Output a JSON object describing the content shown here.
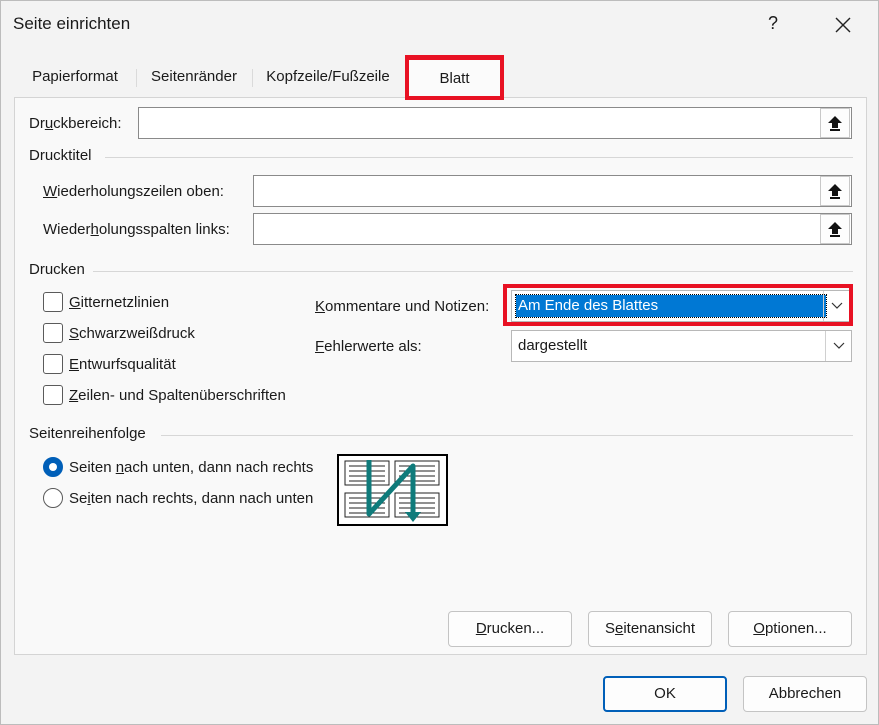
{
  "window": {
    "title": "Seite einrichten",
    "help_label": "?"
  },
  "tabs": [
    {
      "label": "Papierformat"
    },
    {
      "label": "Seitenränder"
    },
    {
      "label": "Kopfzeile/Fußzeile"
    },
    {
      "label": "Blatt",
      "active": true
    }
  ],
  "print_area": {
    "label_pre": "Dr",
    "label_u": "u",
    "label_post": "ckbereich:",
    "value": ""
  },
  "print_titles": {
    "group_label": "Drucktitel",
    "rows_label_u": "W",
    "rows_label_post": "iederholungszeilen oben:",
    "rows_value": "",
    "cols_label_pre": "Wieder",
    "cols_label_u": "h",
    "cols_label_post": "olungsspalten links:",
    "cols_value": ""
  },
  "print": {
    "group_label": "Drucken",
    "checkboxes": [
      {
        "pre": "",
        "u": "G",
        "post": "itternetzlinien",
        "checked": false
      },
      {
        "pre": "",
        "u": "S",
        "post": "chwarzweißdruck",
        "checked": false
      },
      {
        "pre": "",
        "u": "E",
        "post": "ntwurfsqualität",
        "checked": false
      },
      {
        "pre": "",
        "u": "Z",
        "post": "eilen- und Spaltenüberschriften",
        "checked": false
      }
    ],
    "comments_label_u": "K",
    "comments_label_post": "ommentare und Notizen:",
    "comments_value": "Am Ende des Blattes",
    "errors_label_u": "F",
    "errors_label_post": "ehlerwerte als:",
    "errors_value": "dargestellt"
  },
  "page_order": {
    "group_label": "Seitenreihenfolge",
    "option_down_pre": "Seiten ",
    "option_down_u": "n",
    "option_down_post": "ach unten, dann nach rechts",
    "option_right_pre": "Se",
    "option_right_u": "i",
    "option_right_post": "ten nach rechts, dann nach unten",
    "selected": "down"
  },
  "buttons": {
    "print_u": "D",
    "print_post": "rucken...",
    "preview_pre": "S",
    "preview_u": "e",
    "preview_post": "itenansicht",
    "options_u": "O",
    "options_post": "ptionen...",
    "ok": "OK",
    "cancel": "Abbrechen"
  },
  "colors": {
    "accent": "#005fb8",
    "highlight": "#e81123",
    "selection": "#0078d4",
    "arrow": "#0f7b7b"
  },
  "icons": [
    "upload-arrow-icon",
    "close-icon",
    "chevron-down-icon",
    "page-order-preview"
  ]
}
